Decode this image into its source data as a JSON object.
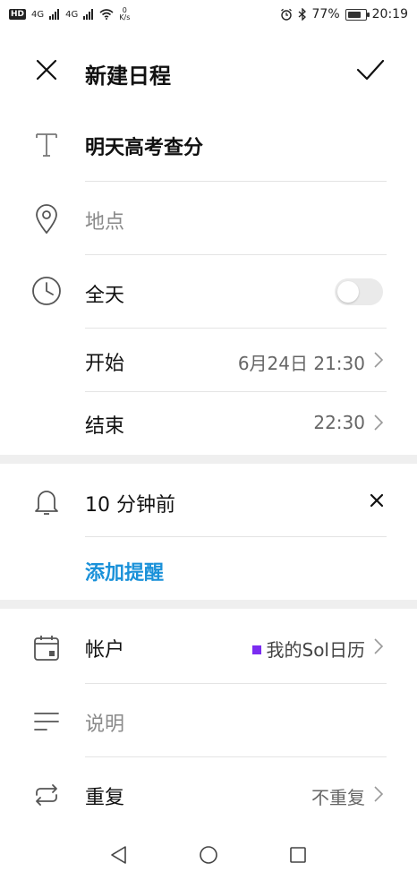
{
  "status_bar": {
    "hd": "HD",
    "signal1": "4G",
    "signal2": "4G",
    "speed_value": "0",
    "speed_unit": "K/s",
    "battery_percent": "77%",
    "time": "20:19",
    "battery_level": 0.77
  },
  "header": {
    "title": "新建日程"
  },
  "event": {
    "title": "明天高考查分",
    "location_placeholder": "地点",
    "all_day_label": "全天",
    "all_day_enabled": false,
    "start_label": "开始",
    "start_value": "6月24日 21:30",
    "end_label": "结束",
    "end_value": "22:30"
  },
  "reminder": {
    "value": "10 分钟前",
    "add_label": "添加提醒"
  },
  "account": {
    "label": "帐户",
    "value": "我的Sol日历",
    "color": "#7b2cf1"
  },
  "description": {
    "placeholder": "说明"
  },
  "repeat": {
    "label": "重复",
    "value": "不重复"
  },
  "colors": {
    "accent": "#1a91d9"
  }
}
